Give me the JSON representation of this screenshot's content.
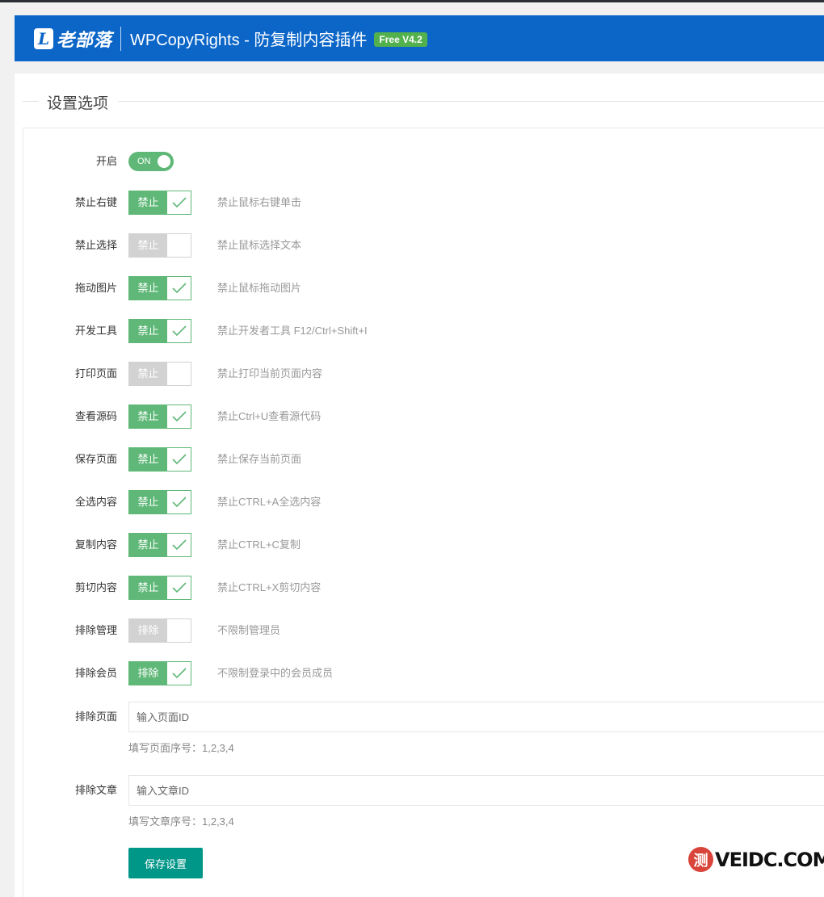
{
  "header": {
    "logo_mark": "L",
    "logo_text": "老部落",
    "title": "WPCopyRights - 防复制内容插件",
    "version": "Free V4.2"
  },
  "section": {
    "title": "设置选项"
  },
  "enable": {
    "label": "开启",
    "state": "ON"
  },
  "options": [
    {
      "label": "禁止右键",
      "tag": "禁止",
      "checked": true,
      "desc": "禁止鼠标右键单击"
    },
    {
      "label": "禁止选择",
      "tag": "禁止",
      "checked": false,
      "desc": "禁止鼠标选择文本"
    },
    {
      "label": "拖动图片",
      "tag": "禁止",
      "checked": true,
      "desc": "禁止鼠标拖动图片"
    },
    {
      "label": "开发工具",
      "tag": "禁止",
      "checked": true,
      "desc": "禁止开发者工具 F12/Ctrl+Shift+I"
    },
    {
      "label": "打印页面",
      "tag": "禁止",
      "checked": false,
      "desc": "禁止打印当前页面内容"
    },
    {
      "label": "查看源码",
      "tag": "禁止",
      "checked": true,
      "desc": "禁止Ctrl+U查看源代码"
    },
    {
      "label": "保存页面",
      "tag": "禁止",
      "checked": true,
      "desc": "禁止保存当前页面"
    },
    {
      "label": "全选内容",
      "tag": "禁止",
      "checked": true,
      "desc": "禁止CTRL+A全选内容"
    },
    {
      "label": "复制内容",
      "tag": "禁止",
      "checked": true,
      "desc": "禁止CTRL+C复制"
    },
    {
      "label": "剪切内容",
      "tag": "禁止",
      "checked": true,
      "desc": "禁止CTRL+X剪切内容"
    },
    {
      "label": "排除管理",
      "tag": "排除",
      "checked": false,
      "desc": "不限制管理员"
    },
    {
      "label": "排除会员",
      "tag": "排除",
      "checked": true,
      "desc": "不限制登录中的会员成员"
    }
  ],
  "exclude_pages": {
    "label": "排除页面",
    "placeholder": "输入页面ID",
    "value": "",
    "help": "填写页面序号：1,2,3,4"
  },
  "exclude_posts": {
    "label": "排除文章",
    "placeholder": "输入文章ID",
    "value": "",
    "help": "填写文章序号：1,2,3,4"
  },
  "save_button": "保存设置",
  "watermark": {
    "mark": "测",
    "text": "VEIDC.COM"
  },
  "colors": {
    "header_bg": "#0b66c8",
    "badge": "#52b04d",
    "checked": "#5fb878",
    "unchecked": "#d2d2d2",
    "save_button": "#009688"
  }
}
